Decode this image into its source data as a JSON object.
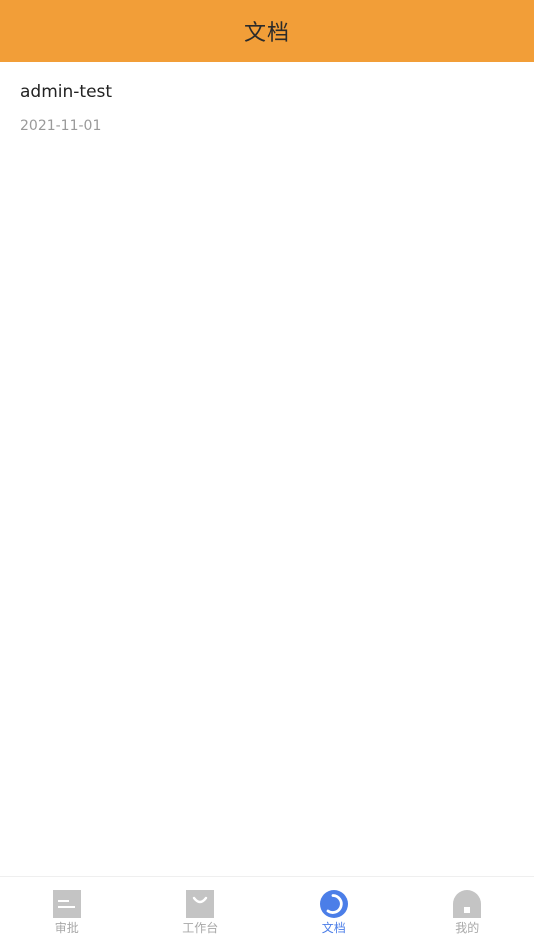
{
  "header": {
    "title": "文档"
  },
  "documents": [
    {
      "title": "admin-test",
      "date": "2021-11-01"
    }
  ],
  "tabbar": {
    "items": [
      {
        "label": "审批",
        "icon": "approval-icon",
        "active": false
      },
      {
        "label": "工作台",
        "icon": "workbench-icon",
        "active": false
      },
      {
        "label": "文档",
        "icon": "document-icon",
        "active": true
      },
      {
        "label": "我的",
        "icon": "profile-icon",
        "active": false
      }
    ]
  },
  "colors": {
    "header_bg": "#f29e38",
    "active_tab": "#4b7ee8",
    "inactive_tab": "#c4c4c4"
  }
}
